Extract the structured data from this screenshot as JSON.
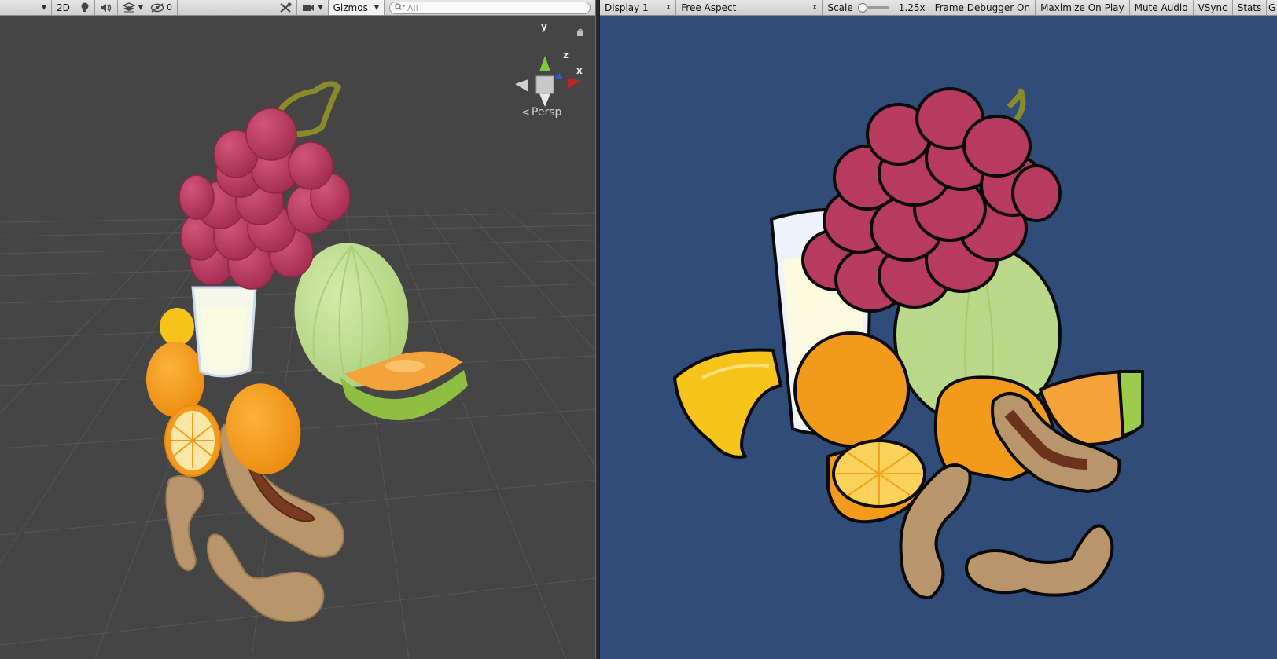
{
  "scene_toolbar": {
    "mode_2d": "2D",
    "hidden_count": "0",
    "gizmos": "Gizmos",
    "search_placeholder": "All"
  },
  "scene_view": {
    "projection": "Persp",
    "axes": {
      "y": "y",
      "z": "z",
      "x": "x"
    }
  },
  "game_toolbar": {
    "display": "Display 1",
    "aspect": "Free Aspect",
    "scale_label": "Scale",
    "scale_value": "1.25x",
    "frame_debugger": "Frame Debugger On",
    "maximize": "Maximize On Play",
    "mute": "Mute Audio",
    "vsync": "VSync",
    "stats": "Stats",
    "gizmos_truncated": "G"
  },
  "colors": {
    "scene_bg": "#454545",
    "game_bg": "#2f4d78",
    "toolbar": "#dcdcdc",
    "grape": "#b13a5a",
    "orange": "#f29a1c",
    "melon": "#b8d88a",
    "tamarind": "#b89468",
    "banana": "#f5c518"
  },
  "icons": [
    "lightbulb-icon",
    "audio-icon",
    "effects-icon",
    "visibility-icon",
    "tools-icon",
    "camera-icon",
    "search-icon",
    "lock-icon",
    "orientation-gizmo-icon"
  ]
}
